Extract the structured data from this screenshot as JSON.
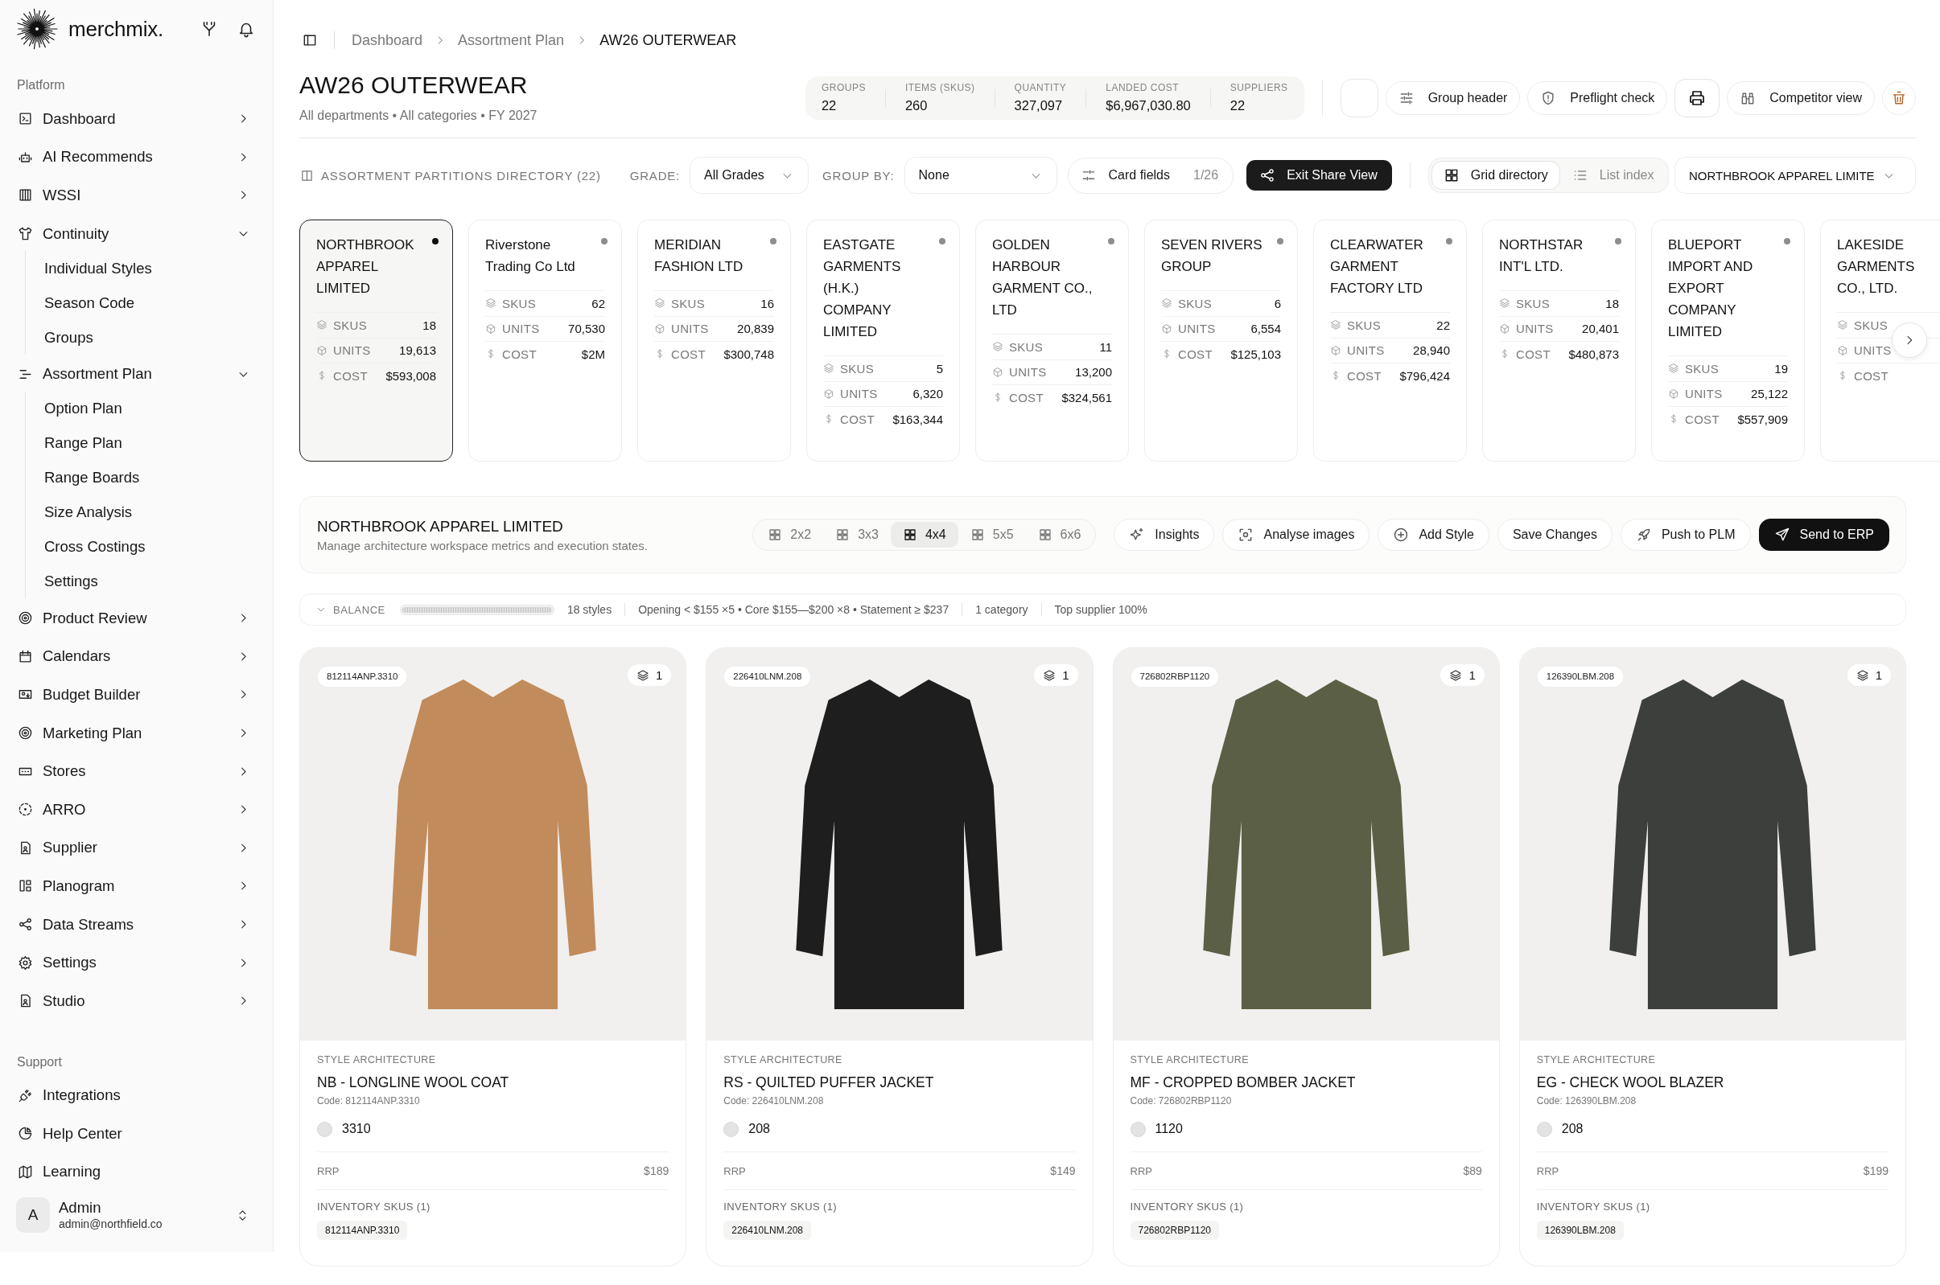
{
  "sidebar": {
    "brand": "merchmix.",
    "sections": [
      {
        "title": "Platform",
        "items": [
          {
            "label": "Dashboard",
            "expanded": false
          },
          {
            "label": "AI Recommends",
            "expanded": false
          },
          {
            "label": "WSSI",
            "expanded": false
          },
          {
            "label": "Continuity",
            "expanded": true,
            "children": [
              {
                "label": "Individual Styles"
              },
              {
                "label": "Season Code"
              },
              {
                "label": "Groups"
              }
            ]
          },
          {
            "label": "Assortment Plan",
            "expanded": true,
            "children": [
              {
                "label": "Option Plan"
              },
              {
                "label": "Range Plan"
              },
              {
                "label": "Range Boards"
              },
              {
                "label": "Size Analysis"
              },
              {
                "label": "Cross Costings"
              },
              {
                "label": "Settings"
              }
            ]
          },
          {
            "label": "Product Review",
            "expanded": false
          },
          {
            "label": "Calendars",
            "expanded": false
          },
          {
            "label": "Budget Builder",
            "expanded": false
          },
          {
            "label": "Marketing Plan",
            "expanded": false
          },
          {
            "label": "Stores",
            "expanded": false
          },
          {
            "label": "ARRO",
            "expanded": false
          },
          {
            "label": "Supplier",
            "expanded": false
          },
          {
            "label": "Planogram",
            "expanded": false
          },
          {
            "label": "Data Streams",
            "expanded": false
          },
          {
            "label": "Settings",
            "expanded": false
          },
          {
            "label": "Studio",
            "expanded": false
          }
        ]
      },
      {
        "title": "Support",
        "items": [
          {
            "label": "Integrations"
          },
          {
            "label": "Help Center"
          },
          {
            "label": "Learning"
          }
        ]
      }
    ],
    "user": {
      "initial": "A",
      "name": "Admin",
      "email": "admin@northfield.co"
    }
  },
  "breadcrumb": [
    {
      "label": "Dashboard",
      "current": false
    },
    {
      "label": "Assortment Plan",
      "current": false
    },
    {
      "label": "AW26 OUTERWEAR",
      "current": true
    }
  ],
  "page": {
    "title": "AW26 OUTERWEAR",
    "subtitle": "All departments • All categories • FY 2027"
  },
  "stats": [
    {
      "label": "GROUPS",
      "value": "22"
    },
    {
      "label": "ITEMS (SKUS)",
      "value": "260"
    },
    {
      "label": "QUANTITY",
      "value": "327,097"
    },
    {
      "label": "LANDED COST",
      "value": "$6,967,030.80"
    },
    {
      "label": "SUPPLIERS",
      "value": "22"
    }
  ],
  "header_actions": [
    {
      "kind": "blank"
    },
    {
      "kind": "button",
      "label": "Group header"
    },
    {
      "kind": "button",
      "label": "Preflight check"
    },
    {
      "kind": "icon"
    },
    {
      "kind": "button",
      "label": "Competitor view"
    },
    {
      "kind": "danger"
    }
  ],
  "directory": {
    "title": "ASSORTMENT PARTITIONS DIRECTORY (22)",
    "filters": [
      {
        "label": "GRADE:",
        "value": "All Grades"
      },
      {
        "label": "GROUP BY:",
        "value": "None"
      }
    ],
    "card_fields": {
      "label": "Card fields",
      "count": "1/26"
    },
    "share_button": "Exit Share View",
    "views": [
      {
        "label": "Grid directory",
        "selected": true
      },
      {
        "label": "List index",
        "selected": false
      }
    ],
    "partition_select": "NORTHBROOK APPAREL LIMITE"
  },
  "partitions": [
    {
      "name": "NORTHBROOK APPAREL LIMITED",
      "selected": true,
      "metrics": [
        {
          "label": "SKUS",
          "value": "18"
        },
        {
          "label": "UNITS",
          "value": "19,613"
        },
        {
          "label": "COST",
          "value": "$593,008"
        }
      ]
    },
    {
      "name": "Riverstone Trading Co Ltd",
      "selected": false,
      "metrics": [
        {
          "label": "SKUS",
          "value": "62"
        },
        {
          "label": "UNITS",
          "value": "70,530"
        },
        {
          "label": "COST",
          "value": "$2M"
        }
      ]
    },
    {
      "name": "MERIDIAN FASHION LTD",
      "selected": false,
      "metrics": [
        {
          "label": "SKUS",
          "value": "16"
        },
        {
          "label": "UNITS",
          "value": "20,839"
        },
        {
          "label": "COST",
          "value": "$300,748"
        }
      ]
    },
    {
      "name": "EASTGATE GARMENTS (H.K.) COMPANY LIMITED",
      "selected": false,
      "metrics": [
        {
          "label": "SKUS",
          "value": "5"
        },
        {
          "label": "UNITS",
          "value": "6,320"
        },
        {
          "label": "COST",
          "value": "$163,344"
        }
      ]
    },
    {
      "name": "GOLDEN HARBOUR GARMENT CO., LTD",
      "selected": false,
      "metrics": [
        {
          "label": "SKUS",
          "value": "11"
        },
        {
          "label": "UNITS",
          "value": "13,200"
        },
        {
          "label": "COST",
          "value": "$324,561"
        }
      ]
    },
    {
      "name": "SEVEN RIVERS GROUP",
      "selected": false,
      "metrics": [
        {
          "label": "SKUS",
          "value": "6"
        },
        {
          "label": "UNITS",
          "value": "6,554"
        },
        {
          "label": "COST",
          "value": "$125,103"
        }
      ]
    },
    {
      "name": "CLEARWATER GARMENT FACTORY LTD",
      "selected": false,
      "metrics": [
        {
          "label": "SKUS",
          "value": "22"
        },
        {
          "label": "UNITS",
          "value": "28,940"
        },
        {
          "label": "COST",
          "value": "$796,424"
        }
      ]
    },
    {
      "name": "NORTHSTAR INT'L LTD.",
      "selected": false,
      "metrics": [
        {
          "label": "SKUS",
          "value": "18"
        },
        {
          "label": "UNITS",
          "value": "20,401"
        },
        {
          "label": "COST",
          "value": "$480,873"
        }
      ]
    },
    {
      "name": "BLUEPORT IMPORT AND EXPORT COMPANY LIMITED",
      "selected": false,
      "metrics": [
        {
          "label": "SKUS",
          "value": "19"
        },
        {
          "label": "UNITS",
          "value": "25,122"
        },
        {
          "label": "COST",
          "value": "$557,909"
        }
      ]
    },
    {
      "name": "LAKESIDE GARMENTS CO., LTD.",
      "selected": false,
      "metrics": [
        {
          "label": "SKUS"
        },
        {
          "label": "UNITS"
        },
        {
          "label": "COST"
        }
      ]
    }
  ],
  "workspace": {
    "title": "NORTHBROOK APPAREL LIMITED",
    "subtitle": "Manage architecture workspace metrics and execution states.",
    "grid_sizes": [
      {
        "label": "2x2",
        "selected": false
      },
      {
        "label": "3x3",
        "selected": false
      },
      {
        "label": "4x4",
        "selected": true
      },
      {
        "label": "5x5",
        "selected": false
      },
      {
        "label": "6x6",
        "selected": false
      }
    ],
    "actions": [
      {
        "kind": "secondary",
        "label": "Insights"
      },
      {
        "kind": "secondary",
        "label": "Analyse images"
      },
      {
        "kind": "secondary",
        "label": "Add Style"
      },
      {
        "kind": "secondary",
        "label": "Save Changes"
      },
      {
        "kind": "secondary",
        "label": "Push to PLM"
      },
      {
        "kind": "primary",
        "label": "Send to ERP"
      }
    ]
  },
  "balance": {
    "label": "BALANCE",
    "level": 1,
    "stats": [
      "18 styles",
      "Opening < $155 ×5 • Core $155—$200 ×8 • Statement ≥ $237",
      "1 category",
      "Top supplier 100%"
    ]
  },
  "products": [
    {
      "code": "812114ANP.3310",
      "count": "1",
      "eyebrow": "STYLE ARCHITECTURE",
      "name": "NB - LONGLINE WOOL COAT",
      "code_line": "Code: 812114ANP.3310",
      "swatch": "3310",
      "price_label": "RRP",
      "price": "$189",
      "inventory_title": "INVENTORY SKUS (1)",
      "skus": [
        "812114ANP.3310"
      ],
      "color": "#c28b5c"
    },
    {
      "code": "226410LNM.208",
      "count": "1",
      "eyebrow": "STYLE ARCHITECTURE",
      "name": "RS - QUILTED PUFFER JACKET",
      "code_line": "Code: 226410LNM.208",
      "swatch": "208",
      "price_label": "RRP",
      "price": "$149",
      "inventory_title": "INVENTORY SKUS (1)",
      "skus": [
        "226410LNM.208"
      ],
      "color": "#1e1e1e"
    },
    {
      "code": "726802RBP1120",
      "count": "1",
      "eyebrow": "STYLE ARCHITECTURE",
      "name": "MF - CROPPED BOMBER JACKET",
      "code_line": "Code: 726802RBP1120",
      "swatch": "1120",
      "price_label": "RRP",
      "price": "$89",
      "inventory_title": "INVENTORY SKUS (1)",
      "skus": [
        "726802RBP1120"
      ],
      "color": "#5b5f45"
    },
    {
      "code": "126390LBM.208",
      "count": "1",
      "eyebrow": "STYLE ARCHITECTURE",
      "name": "EG - CHECK WOOL BLAZER",
      "code_line": "Code: 126390LBM.208",
      "swatch": "208",
      "price_label": "RRP",
      "price": "$199",
      "inventory_title": "INVENTORY SKUS (1)",
      "skus": [
        "126390LBM.208"
      ],
      "color": "#3d3f3c"
    }
  ]
}
